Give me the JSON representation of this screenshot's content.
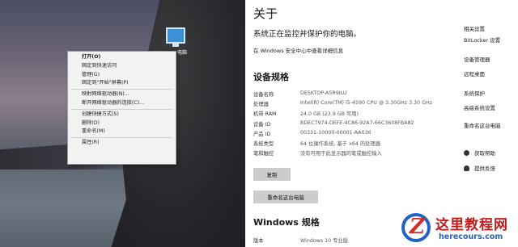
{
  "desktop": {
    "icon_label": "电脑"
  },
  "context_menu": {
    "items": [
      {
        "label": "打开(O)",
        "bold": true
      },
      {
        "label": "固定到快速访问"
      },
      {
        "label": "管理(G)"
      },
      {
        "label": "固定到\"开始\"屏幕(P)"
      },
      {
        "sep": true
      },
      {
        "label": "映射网络驱动器(N)..."
      },
      {
        "label": "断开网络驱动器的连接(C)..."
      },
      {
        "sep": true
      },
      {
        "label": "创建快捷方式(S)"
      },
      {
        "label": "删除(D)"
      },
      {
        "label": "重命名(M)"
      },
      {
        "sep": true
      },
      {
        "label": "属性(R)"
      }
    ]
  },
  "about": {
    "title": "关于",
    "status": "系统正在监控并保护你的电脑。",
    "security_link": "在 Windows 安全中心中查看详细信息",
    "device_specs_title": "设备规格",
    "specs": [
      {
        "key": "设备名称",
        "value": "DESKTOP-A5R9ILU"
      },
      {
        "key": "处理器",
        "value": "Intel(R) Core(TM) i5-4590 CPU @ 3.30GHz   3.30 GHz"
      },
      {
        "key": "机带 RAM",
        "value": "24.0 GB (23.9 GB 可用)"
      },
      {
        "key": "设备 ID",
        "value": "BDEC7974-DEFE-4C86-92A7-66C3608FBA82"
      },
      {
        "key": "产品 ID",
        "value": "00331-10000-00001-AA036"
      },
      {
        "key": "系统类型",
        "value": "64 位操作系统, 基于 x64 的处理器"
      },
      {
        "key": "笔和触控",
        "value": "没有可用于此显示器的笔或触控输入"
      }
    ],
    "copy_button": "复制",
    "rename_button": "重命名这台电脑",
    "windows_specs_title": "Windows 规格",
    "edition_key": "版本",
    "edition_value": "Windows 10 专业版"
  },
  "related": {
    "links": [
      "相关设置",
      "BitLocker 设置",
      "设备管理器",
      "远程桌面",
      "系统保护",
      "高级系统设置",
      "重命名这台电脑"
    ],
    "help": [
      "获取帮助",
      "提供反馈"
    ]
  },
  "watermark": {
    "name": "这里教程网",
    "url": "herecours.com"
  }
}
